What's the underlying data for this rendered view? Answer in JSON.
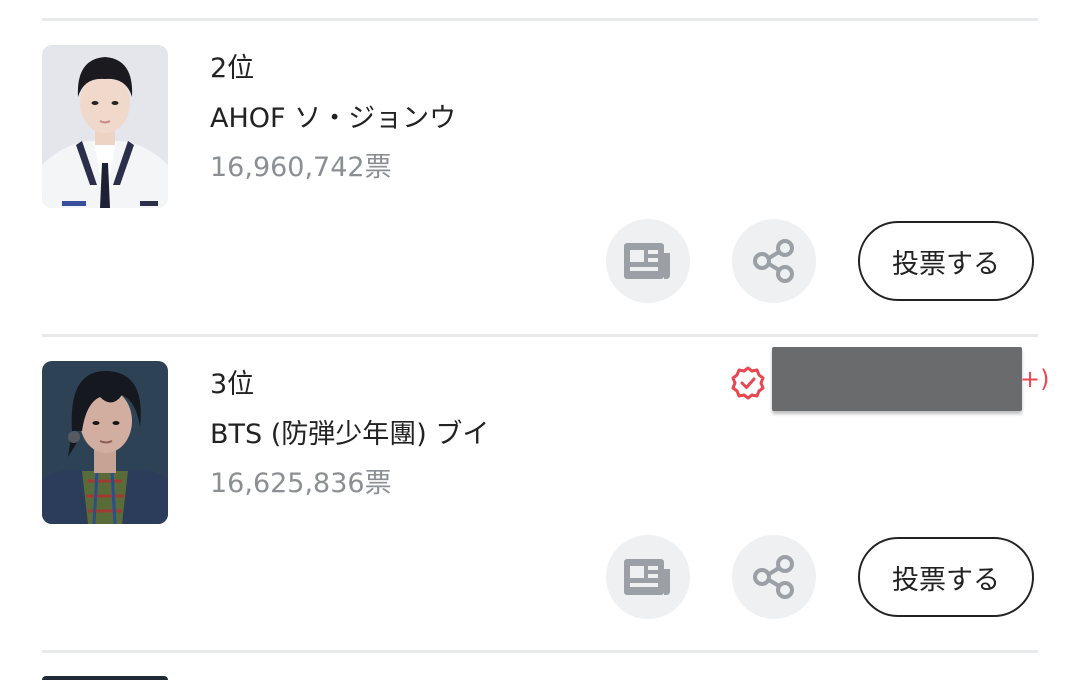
{
  "entries": [
    {
      "rank": "2位",
      "name": "AHOF ソ・ジョンウ",
      "votes": "16,960,742票",
      "vote_label": "投票する",
      "icons": {
        "news": "newspaper-icon",
        "share": "share-icon"
      }
    },
    {
      "rank": "3位",
      "name": "BTS (防弾少年團) ブイ",
      "votes": "16,625,836票",
      "vote_label": "投票する",
      "badge_icon": "verified-badge-icon",
      "badge_paren": "+)",
      "icons": {
        "news": "newspaper-icon",
        "share": "share-icon"
      }
    }
  ],
  "colors": {
    "divider": "#e8e9eb",
    "badge_red": "#e8474f",
    "vote_count": "#8b8f94",
    "icon_gray": "#9aa0a6",
    "icon_bg": "#eef0f2"
  }
}
